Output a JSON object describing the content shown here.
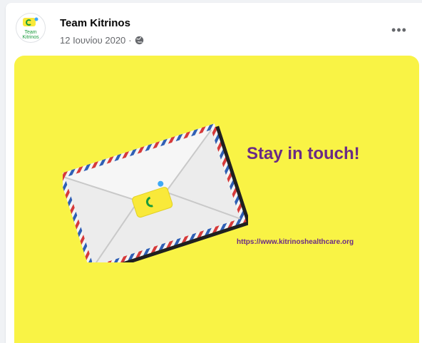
{
  "post": {
    "author": "Team Kitrinos",
    "avatar_text_line1": "Team",
    "avatar_text_line2": "Kitrinos",
    "date": "12 Ιουνίου 2020",
    "separator": "·",
    "privacy_icon": "globe-icon",
    "more_icon": "more-options-icon",
    "more_label": "•••"
  },
  "media": {
    "headline": "Stay in touch!",
    "url": "https://www.kitrinoshealthcare.org",
    "background_color": "#f9f345",
    "text_color": "#6a2a86"
  }
}
